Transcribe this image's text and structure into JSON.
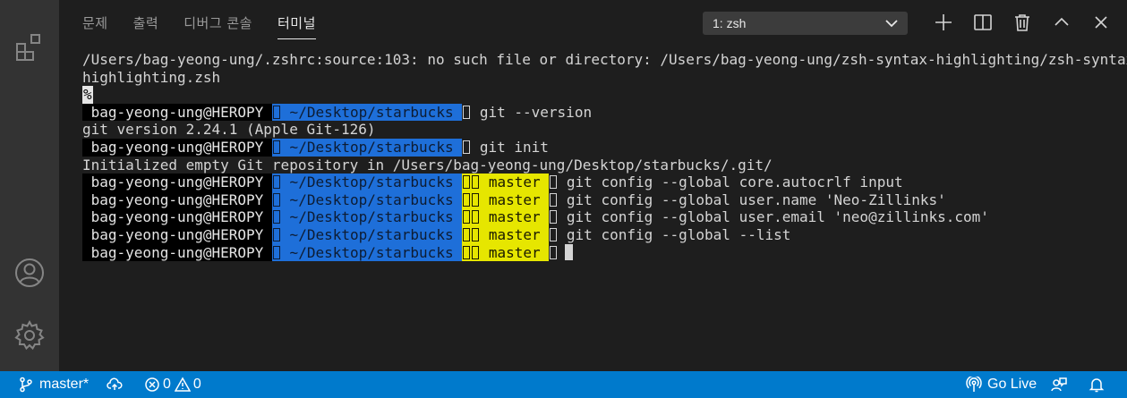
{
  "panel": {
    "tabs": [
      {
        "label": "문제",
        "active": false
      },
      {
        "label": "출력",
        "active": false
      },
      {
        "label": "디버그 콘솔",
        "active": false
      },
      {
        "label": "터미널",
        "active": true
      }
    ],
    "terminal_selector": "1: zsh"
  },
  "terminal": {
    "error_line_1": "/Users/bag-yeong-ung/.zshrc:source:103: no such file or directory: /Users/bag-yeong-ung/zsh-syntax-highlighting/zsh-syntax-",
    "error_line_2": "highlighting.zsh",
    "percent": "%",
    "user_host": " bag-yeong-ung@HEROPY ",
    "path": " ~/Desktop/starbucks ",
    "branch": " master ",
    "lines": [
      {
        "type": "prompt",
        "git": false,
        "cmd": " git --version"
      },
      {
        "type": "output",
        "text": "git version 2.24.1 (Apple Git-126)"
      },
      {
        "type": "prompt",
        "git": false,
        "cmd": " git init"
      },
      {
        "type": "output",
        "text": "Initialized empty Git repository in /Users/bag-yeong-ung/Desktop/starbucks/.git/"
      },
      {
        "type": "prompt",
        "git": true,
        "cmd": " git config --global core.autocrlf input"
      },
      {
        "type": "prompt",
        "git": true,
        "cmd": " git config --global user.name 'Neo-Zillinks'"
      },
      {
        "type": "prompt",
        "git": true,
        "cmd": " git config --global user.email 'neo@zillinks.com'"
      },
      {
        "type": "prompt",
        "git": true,
        "cmd": " git config --global --list"
      },
      {
        "type": "prompt",
        "git": true,
        "cmd": "",
        "cursor": true
      }
    ]
  },
  "status_bar": {
    "branch": "master*",
    "errors": "0",
    "warnings": "0",
    "go_live": "Go Live"
  },
  "colors": {
    "status_bar": "#007acc",
    "path_segment": "#1e6fd9",
    "git_segment": "#e6e600",
    "terminal_bg": "#1e1e1e"
  }
}
